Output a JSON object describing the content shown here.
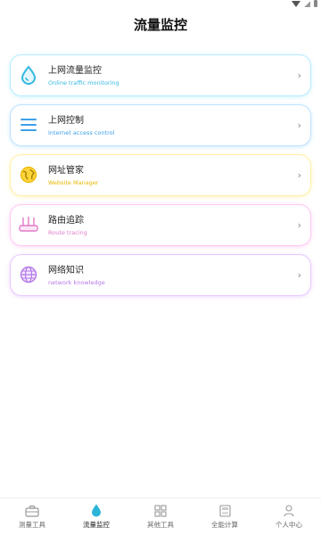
{
  "header": {
    "title": "流量监控"
  },
  "menu": [
    {
      "title": "上网流量监控",
      "subtitle": "Online traffic monitoring",
      "icon": "water-drop-icon",
      "accent": "#35b9e0",
      "glow": "#b7ecff"
    },
    {
      "title": "上网控制",
      "subtitle": "Internet access control",
      "icon": "list-lines-icon",
      "accent": "#3da0e8",
      "glow": "#bfe2ff"
    },
    {
      "title": "网址管家",
      "subtitle": "Website Manager",
      "icon": "globe-icon",
      "accent": "#e9b700",
      "glow": "#fff0a8"
    },
    {
      "title": "路由追踪",
      "subtitle": "Route tracing",
      "icon": "router-icon",
      "accent": "#e07ac8",
      "glow": "#ffc9f1"
    },
    {
      "title": "网络知识",
      "subtitle": "network knowledge",
      "icon": "network-globe-icon",
      "accent": "#b57ae8",
      "glow": "#e8c9ff"
    }
  ],
  "tabbar": [
    {
      "label": "测量工具",
      "icon": "toolbox-icon",
      "active": false
    },
    {
      "label": "流量监控",
      "icon": "water-drop-icon",
      "active": true
    },
    {
      "label": "其他工具",
      "icon": "grid-icon",
      "active": false
    },
    {
      "label": "全能计算",
      "icon": "calculator-icon",
      "active": false
    },
    {
      "label": "个人中心",
      "icon": "person-icon",
      "active": false
    }
  ]
}
